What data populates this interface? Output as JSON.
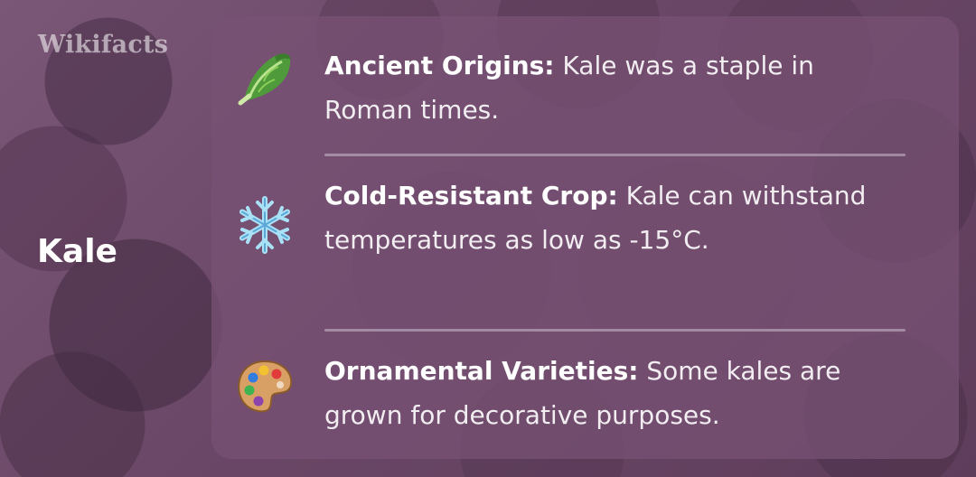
{
  "brand": "Wikifacts",
  "title": "Kale",
  "facts": [
    {
      "icon": "leafy-green-icon",
      "heading": "Ancient Origins:",
      "text": "Kale was a staple in Roman times."
    },
    {
      "icon": "snowflake-icon",
      "heading": "Cold-Resistant Crop:",
      "text": "Kale can withstand temperatures as low as -15°C."
    },
    {
      "icon": "artist-palette-icon",
      "heading": "Ornamental Varieties:",
      "text": "Some kales are grown for decorative purposes."
    }
  ],
  "colors": {
    "background": "#6b4a67",
    "panel": "#78527480",
    "text": "#ffffff"
  }
}
